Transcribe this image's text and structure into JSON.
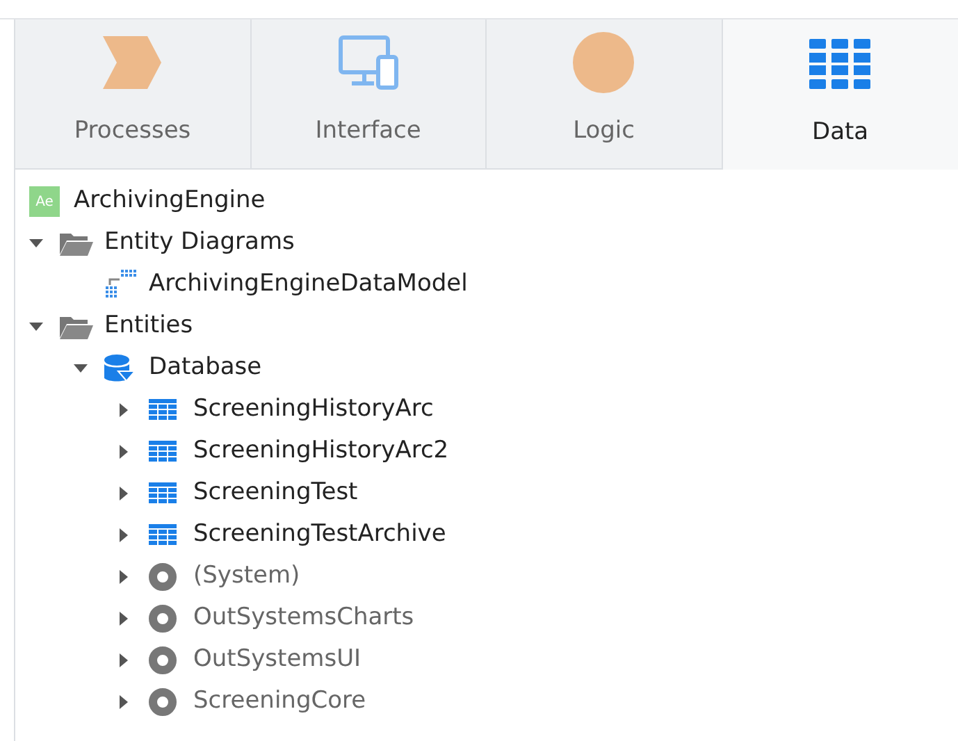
{
  "tabs": [
    {
      "label": "Processes",
      "kind": "processes",
      "selected": false
    },
    {
      "label": "Interface",
      "kind": "interface",
      "selected": false
    },
    {
      "label": "Logic",
      "kind": "logic",
      "selected": false
    },
    {
      "label": "Data",
      "kind": "data",
      "selected": true
    }
  ],
  "tree": [
    {
      "label": "ArchivingEngine",
      "kind": "module",
      "badge": "Ae",
      "children": [
        {
          "label": "Entity Diagrams",
          "kind": "folder",
          "expanded": true,
          "children": [
            {
              "label": "ArchivingEngineDataModel",
              "kind": "diagram"
            }
          ]
        },
        {
          "label": "Entities",
          "kind": "folder",
          "expanded": true,
          "children": [
            {
              "label": "Database",
              "kind": "database",
              "expanded": true,
              "children": [
                {
                  "label": "ScreeningHistoryArc",
                  "kind": "entity",
                  "expanded": false
                },
                {
                  "label": "ScreeningHistoryArc2",
                  "kind": "entity",
                  "expanded": false
                },
                {
                  "label": "ScreeningTest",
                  "kind": "entity",
                  "expanded": false
                },
                {
                  "label": "ScreeningTestArchive",
                  "kind": "entity",
                  "expanded": false
                },
                {
                  "label": "(System)",
                  "kind": "reference",
                  "expanded": false
                },
                {
                  "label": "OutSystemsCharts",
                  "kind": "reference",
                  "expanded": false
                },
                {
                  "label": "OutSystemsUI",
                  "kind": "reference",
                  "expanded": false
                },
                {
                  "label": "ScreeningCore",
                  "kind": "reference",
                  "expanded": false
                }
              ]
            }
          ]
        }
      ]
    }
  ]
}
